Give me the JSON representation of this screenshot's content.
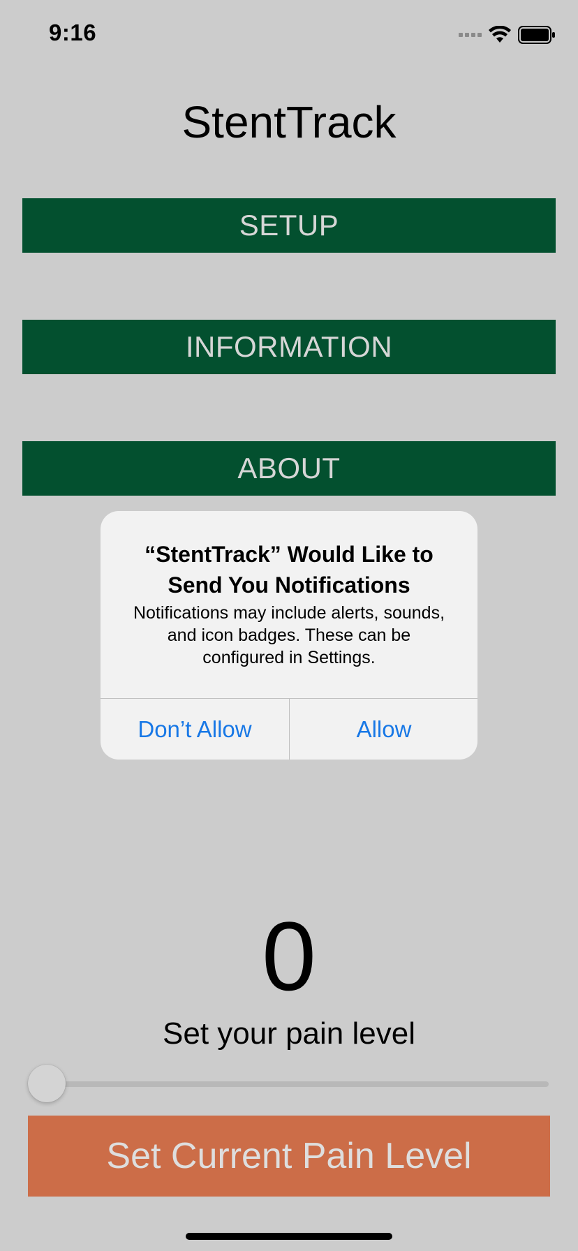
{
  "status_bar": {
    "time": "9:16"
  },
  "app": {
    "title": "StentTrack"
  },
  "menu": {
    "setup_label": "SETUP",
    "information_label": "INFORMATION",
    "about_label": "ABOUT"
  },
  "alert": {
    "title": "“StentTrack” Would Like to Send You Notifications",
    "message": "Notifications may include alerts, sounds, and icon badges. These can be configured in Settings.",
    "dont_allow_label": "Don’t Allow",
    "allow_label": "Allow"
  },
  "pain": {
    "value": "0",
    "label": "Set your pain level",
    "slider_fraction": 0,
    "submit_label": "Set Current Pain Level"
  },
  "colors": {
    "background": "#cccccc",
    "menu_green": "#03502f",
    "submit_orange": "#cc6d48",
    "link_blue": "#1878e6"
  },
  "icons": {
    "signal": "cellular-signal-icon",
    "wifi": "wifi-icon",
    "battery": "battery-icon"
  }
}
